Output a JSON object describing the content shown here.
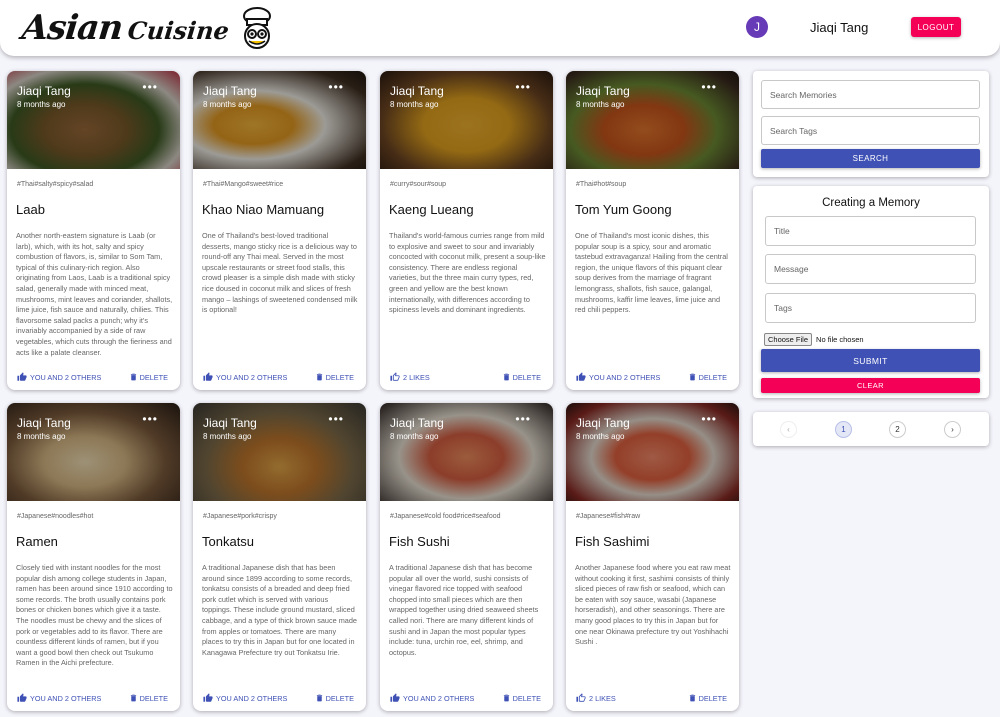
{
  "brand": {
    "name_part1": "Asian",
    "name_part2": "Cuisine"
  },
  "user": {
    "initial": "J",
    "name": "Jiaqi Tang",
    "logout_label": "LOGOUT"
  },
  "colors": {
    "primary": "#3f51b5",
    "secondary": "#f50057",
    "avatar": "#673ab7"
  },
  "posts": [
    {
      "author": "Jiaqi Tang",
      "time": "8 months ago",
      "more": "•••",
      "tags": "#Thai#salty#spicy#salad",
      "title": "Laab",
      "message": "Another north-eastern signature is Laab (or larb), which, with its hot, salty and spicy combustion of flavors, is, similar to Som Tam, typical of this culinary-rich region. Also originating from Laos, Laab is a traditional spicy salad, generally made with minced meat, mushrooms, mint leaves and coriander, shallots, lime juice, fish sauce and naturally, chilies. This flavorsome salad packs a punch; why it's invariably accompanied by a side of raw vegetables, which cuts through the fieriness and acts like a palate cleanser.",
      "like_label": "YOU AND 2 OTHERS",
      "delete_label": "DELETE",
      "image": "laab-photo"
    },
    {
      "author": "Jiaqi Tang",
      "time": "8 months ago",
      "more": "•••",
      "tags": "#Thai#Mango#sweet#rice",
      "title": "Khao Niao Mamuang",
      "message": "One of Thailand's best-loved traditional desserts, mango sticky rice is a delicious way to round-off any Thai meal. Served in the most upscale restaurants or street food stalls, this crowd pleaser is a simple dish made with sticky rice doused in coconut milk and slices of fresh mango – lashings of sweetened condensed milk is optional!",
      "like_label": "YOU AND 2 OTHERS",
      "delete_label": "DELETE",
      "image": "mango-sticky-rice-photo"
    },
    {
      "author": "Jiaqi Tang",
      "time": "8 months ago",
      "more": "•••",
      "tags": "#curry#sour#soup",
      "title": "Kaeng Lueang",
      "message": "Thailand's world-famous curries range from mild to explosive and sweet to sour and invariably concocted with coconut milk, present a soup-like consistency. There are endless regional varieties, but the three main curry types, red, green and yellow are the best known internationally, with differences according to spiciness levels and dominant ingredients.",
      "like_label": "2 LIKES",
      "delete_label": "DELETE",
      "image": "yellow-curry-photo"
    },
    {
      "author": "Jiaqi Tang",
      "time": "8 months ago",
      "more": "•••",
      "tags": "#Thai#hot#soup",
      "title": "Tom Yum Goong",
      "message": "One of Thailand's most iconic dishes, this popular soup is a spicy, sour and aromatic tastebud extravaganza! Hailing from the central region, the unique flavors of this piquant clear soup derives from the marriage of fragrant lemongrass, shallots, fish sauce, galangal, mushrooms, kaffir lime leaves, lime juice and red chili peppers.",
      "like_label": "YOU AND 2 OTHERS",
      "delete_label": "DELETE",
      "image": "tom-yum-photo"
    },
    {
      "author": "Jiaqi Tang",
      "time": "8 months ago",
      "more": "•••",
      "tags": "#Japanese#noodles#hot",
      "title": "Ramen",
      "message": "Closely tied with instant noodles for the most popular dish among college students in Japan, ramen has been around since 1910 according to some records. The broth usually contains pork bones or chicken bones which give it a taste. The noodles must be chewy and the slices of pork or vegetables add to its flavor. There are countless different kinds of ramen, but if you want a good bowl then check out Tsukumo Ramen in the Aichi prefecture.",
      "like_label": "YOU AND 2 OTHERS",
      "delete_label": "DELETE",
      "image": "ramen-photo"
    },
    {
      "author": "Jiaqi Tang",
      "time": "8 months ago",
      "more": "•••",
      "tags": "#Japanese#pork#crispy",
      "title": "Tonkatsu",
      "message": "A traditional Japanese dish that has been around since 1899 according to some records, tonkatsu consists of a breaded and deep fried pork cutlet which is served with various toppings. These include ground mustard, sliced cabbage, and a type of thick brown sauce made from apples or tomatoes. There are many places to try this in Japan but for one located in Kanagawa Prefecture try out Tonkatsu Irie.",
      "like_label": "YOU AND 2 OTHERS",
      "delete_label": "DELETE",
      "image": "tonkatsu-photo"
    },
    {
      "author": "Jiaqi Tang",
      "time": "8 months ago",
      "more": "•••",
      "tags": "#Japanese#cold food#rice#seafood",
      "title": "Fish Sushi",
      "message": "A traditional Japanese dish that has become popular all over the world, sushi consists of vinegar flavored rice topped with seafood chopped into small pieces which are then wrapped together using dried seaweed sheets called nori. There are many different kinds of sushi and in Japan the most popular types include: tuna, urchin roe, eel, shrimp, and octopus.",
      "like_label": "YOU AND 2 OTHERS",
      "delete_label": "DELETE",
      "image": "sushi-photo"
    },
    {
      "author": "Jiaqi Tang",
      "time": "8 months ago",
      "more": "•••",
      "tags": "#Japanese#fish#raw",
      "title": "Fish Sashimi",
      "message": "Another Japanese food where you eat raw meat without cooking it first, sashimi consists of thinly sliced pieces of raw fish or seafood, which can be eaten with soy sauce, wasabi (Japanese horseradish), and other seasonings. There are many good places to try this in Japan but for one near Okinawa prefecture try out Yoshihachi Sushi .",
      "like_label": "2 LIKES",
      "delete_label": "DELETE",
      "image": "sashimi-photo"
    }
  ],
  "search": {
    "memories_placeholder": "Search Memories",
    "tags_placeholder": "Search Tags",
    "button_label": "SEARCH"
  },
  "form": {
    "heading": "Creating a Memory",
    "title_placeholder": "Title",
    "message_placeholder": "Message",
    "tags_placeholder": "Tags",
    "file_button_label": "Choose File",
    "file_status": "No file chosen",
    "submit_label": "SUBMIT",
    "clear_label": "CLEAR"
  },
  "pagination": {
    "prev_icon": "chevron-left-icon",
    "pages": [
      "1",
      "2"
    ],
    "current": "1",
    "next_icon": "chevron-right-icon"
  }
}
